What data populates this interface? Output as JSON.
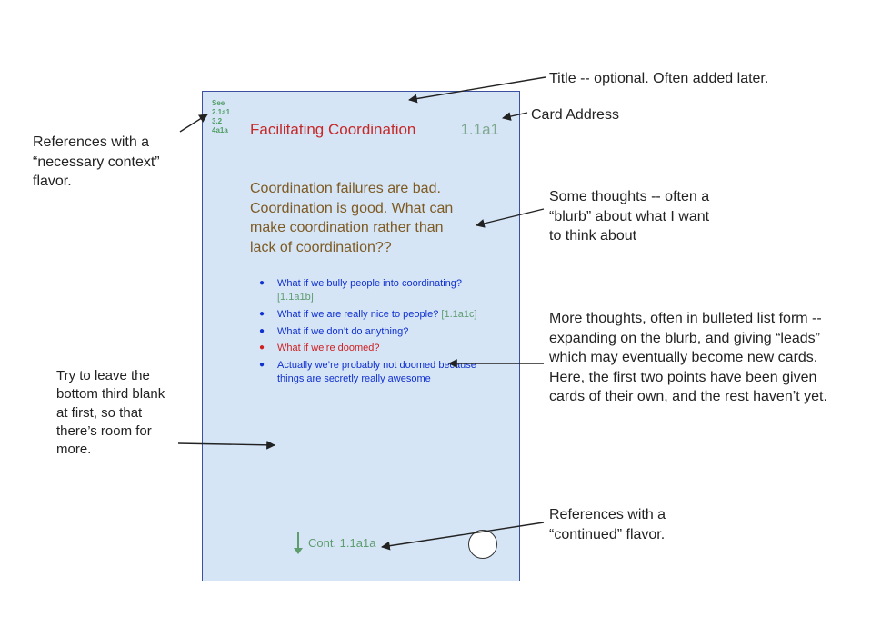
{
  "card": {
    "see_label": "See",
    "see_refs": [
      "2.1a1",
      "3.2",
      "4a1a"
    ],
    "title": "Facilitating Coordination",
    "address": "1.1a1",
    "blurb": "Coordination failures are bad. Coordination is good. What can make coordination rather than lack of coordination??",
    "bullets": [
      {
        "text": "What if we bully people into coordinating?",
        "ref": "[1.1a1b]",
        "style": "blue"
      },
      {
        "text": "What if we are really nice to people?",
        "ref": "[1.1a1c]",
        "style": "blue"
      },
      {
        "text": "What if we don’t do anything?",
        "ref": "",
        "style": "blue"
      },
      {
        "text": "What if we’re doomed?",
        "ref": "",
        "style": "red"
      },
      {
        "text": "Actually we’re probably not doomed because things are secretly really awesome",
        "ref": "",
        "style": "blue"
      }
    ],
    "cont_label": "Cont. 1.1a1a"
  },
  "annotations": {
    "title_note": "Title -- optional. Often added later.",
    "address_note": "Card Address",
    "see_note": "References with a “necessary context” flavor.",
    "blurb_note": "Some thoughts -- often a “blurb” about what I want to think about",
    "bullets_note": "More thoughts, often in bulleted list form -- expanding on the blurb, and giving “leads” which may eventually become new cards. Here, the first two points have been given cards of their own, and the rest haven’t yet.",
    "bottom_note": "Try to leave the bottom third blank at first, so that there’s room for more.",
    "cont_note": "References with a “continued” flavor."
  }
}
